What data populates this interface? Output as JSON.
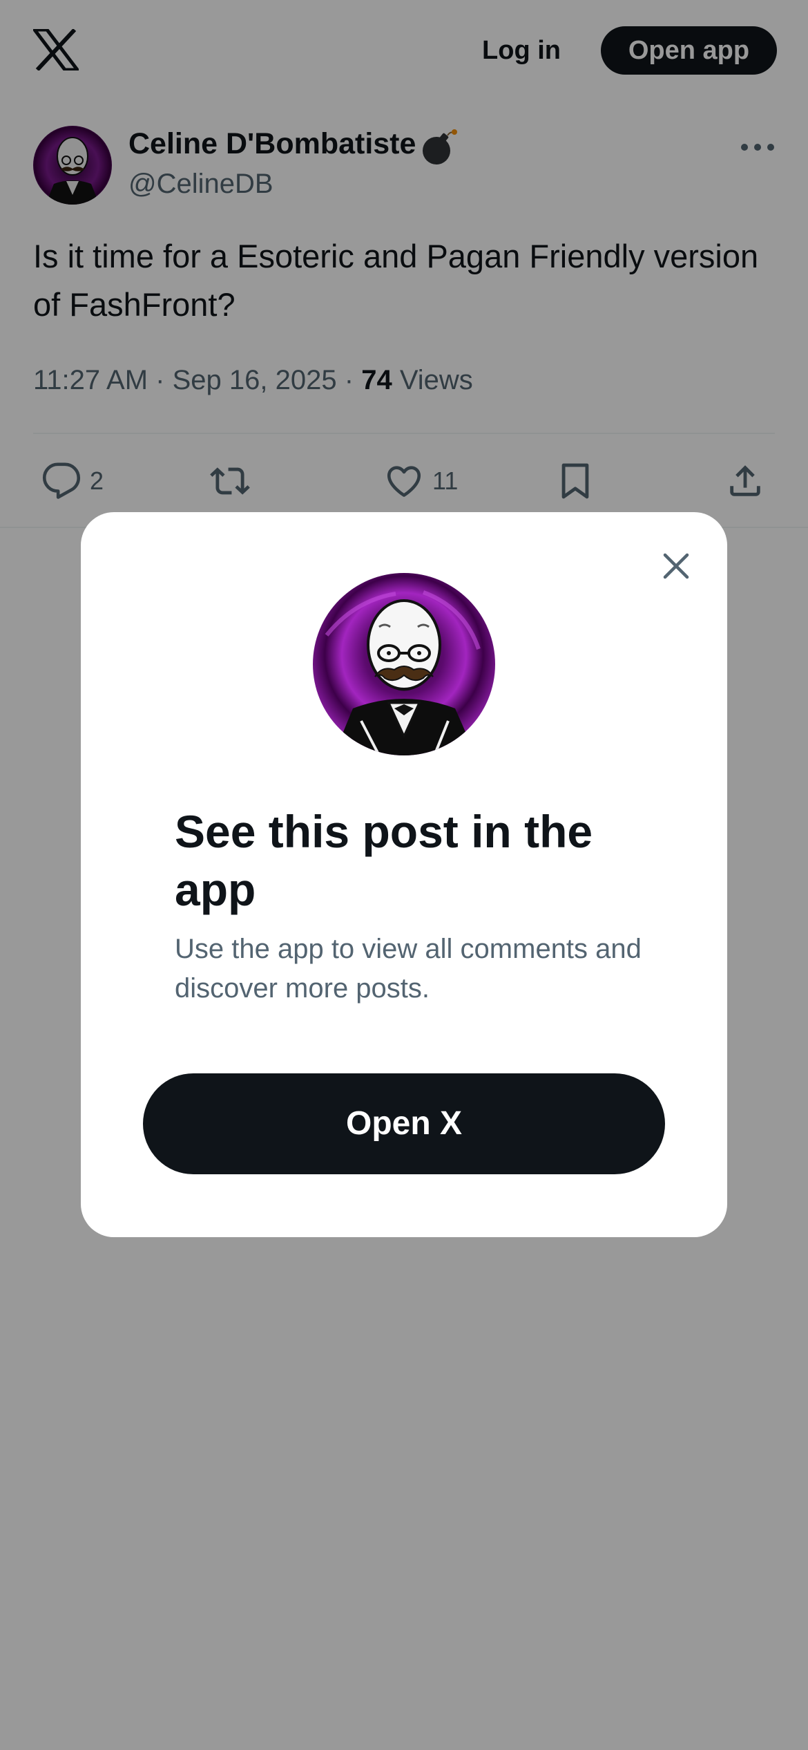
{
  "header": {
    "logo_icon": "x-logo-icon",
    "login_label": "Log in",
    "open_app_label": "Open app"
  },
  "post": {
    "author_name": "Celine D'Bombatiste",
    "author_badge_icon": "bomb-icon",
    "author_handle": "@CelineDB",
    "text": "Is it time for a Esoteric and Pagan Friendly version of FashFront?",
    "time": "11:27 AM",
    "separator": "·",
    "date": "Sep 16, 2025",
    "views_count": "74",
    "views_label": "Views",
    "actions": {
      "replies": "2",
      "likes": "11"
    }
  },
  "modal": {
    "title": "See this post in the app",
    "subtitle": "Use the app to view all comments and discover more posts.",
    "button_label": "Open X",
    "close_icon": "close-icon"
  },
  "colors": {
    "text_primary": "#0f1419",
    "text_secondary": "#536471",
    "button_bg": "#0f1419",
    "avatar_purple": "#7a1a8c"
  }
}
